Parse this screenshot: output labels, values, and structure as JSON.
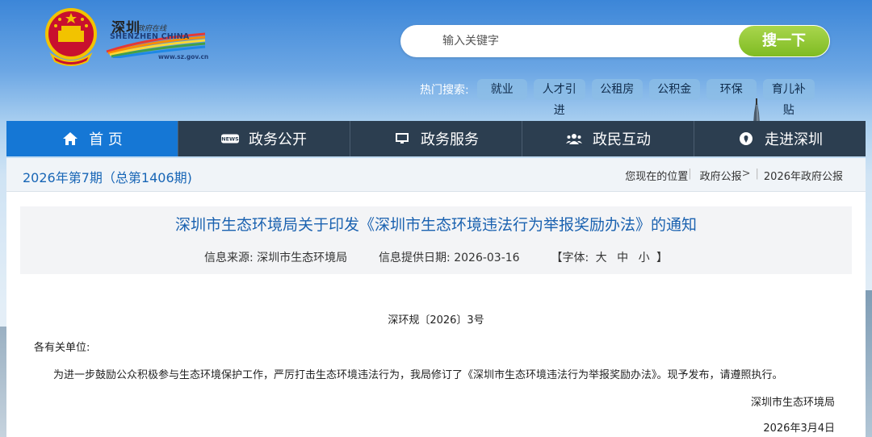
{
  "header": {
    "logo_cn": "深圳",
    "logo_sub": "政府在线",
    "logo_en": "SHENZHEN CHINA",
    "logo_url": "www.sz.gov.cn"
  },
  "search": {
    "placeholder": "输入关键字",
    "button_label": "搜一下"
  },
  "hot_search": {
    "label": "热门搜索:",
    "tags": [
      "就业",
      "人才引进",
      "公租房",
      "公积金",
      "环保",
      "育儿补贴"
    ]
  },
  "nav": {
    "items": [
      {
        "label": "首 页",
        "icon": "home-icon",
        "active": true
      },
      {
        "label": "政务公开",
        "icon": "news-icon",
        "active": false
      },
      {
        "label": "政务服务",
        "icon": "monitor-icon",
        "active": false
      },
      {
        "label": "政民互动",
        "icon": "users-icon",
        "active": false
      },
      {
        "label": "走进深圳",
        "icon": "location-icon",
        "active": false
      }
    ]
  },
  "breadcrumb": {
    "issue": "2026年第7期（总第1406期)",
    "you_are_here": "您现在的位置",
    "level1": "政府公报",
    "sep": ">",
    "level2": "2026年政府公报"
  },
  "article": {
    "title": "深圳市生态环境局关于印发《深圳市生态环境违法行为举报奖励办法》的通知",
    "source_label": "信息来源:",
    "source": "深圳市生态环境局",
    "date_label": "信息提供日期:",
    "date": "2026-03-16",
    "font_label": "【字体:",
    "font_large": "大",
    "font_medium": "中",
    "font_small": "小",
    "font_end": "】",
    "doc_number": "深环规〔2026〕3号",
    "greeting": "各有关单位:",
    "body": "为进一步鼓励公众积极参与生态环境保护工作，严厉打击生态环境违法行为，我局修订了《深圳市生态环境违法行为举报奖励办法》。现予发布，请遵照执行。",
    "signer": "深圳市生态环境局",
    "sign_date": "2026年3月4日"
  },
  "colors": {
    "nav_bg": "#2c3e50",
    "nav_active": "#1577d5",
    "search_button": "#8cc63f",
    "title_color": "#1b62b0"
  }
}
